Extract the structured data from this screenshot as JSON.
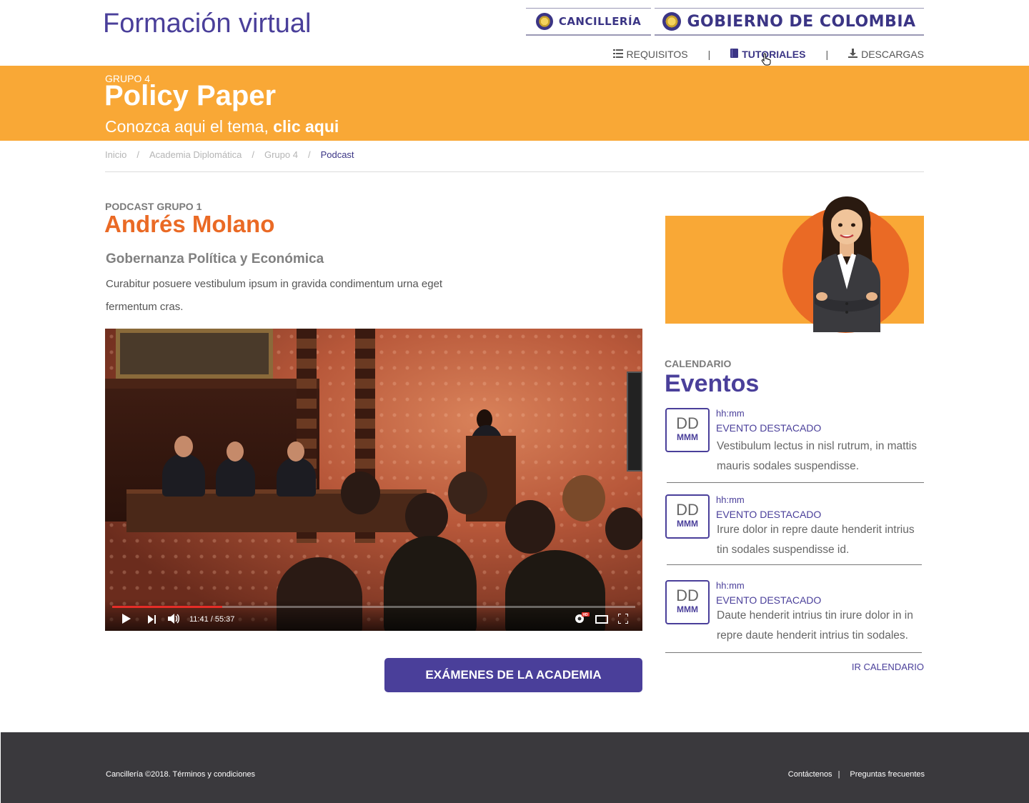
{
  "header": {
    "site_title": "Formación virtual",
    "brand_cancilleria": "CANCILLERÍA",
    "brand_gobierno": "GOBIERNO DE COLOMBIA"
  },
  "nav": {
    "items": [
      {
        "label": "REQUISITOS",
        "icon": "list-icon"
      },
      {
        "label": "TUTORIALES",
        "icon": "book-icon",
        "active": true
      },
      {
        "label": "DESCARGAS",
        "icon": "download-icon"
      }
    ],
    "separator": "|"
  },
  "banner": {
    "group": "GRUPO 4",
    "title": "Policy Paper",
    "subtitle_prefix": "Conozca aqui el tema, ",
    "subtitle_link": "clic aqui"
  },
  "breadcrumb": {
    "items": [
      "Inicio",
      "Academia Diplomática",
      "Grupo 4",
      "Podcast"
    ],
    "separator": "/"
  },
  "content": {
    "kicker": "PODCAST GRUPO 1",
    "name": "Andrés Molano",
    "topic": "Gobernanza Política y Económica",
    "description": "Curabitur posuere vestibulum ipsum in gravida condimentum urna eget fermentum cras."
  },
  "video": {
    "time": "11:41 / 55:37",
    "progress": 0.21,
    "hd_badge": "HD"
  },
  "exam_button": "EXÁMENES DE LA ACADEMIA",
  "calendar": {
    "kicker": "CALENDARIO",
    "title": "Eventos",
    "events": [
      {
        "day": "DD",
        "month": "MMM",
        "time": "hh:mm",
        "title": "EVENTO DESTACADO",
        "desc": "Vestibulum lectus in nisl rutrum, in mattis mauris sodales suspendisse."
      },
      {
        "day": "DD",
        "month": "MMM",
        "time": "hh:mm",
        "title": "EVENTO DESTACADO",
        "desc": "Irure dolor in repre daute henderit intrius tin sodales suspendisse id."
      },
      {
        "day": "DD",
        "month": "MMM",
        "time": "hh:mm",
        "title": "EVENTO DESTACADO",
        "desc": "Daute henderit intrius tin irure dolor in in repre daute henderit intrius tin sodales."
      }
    ],
    "link": "IR CALENDARIO"
  },
  "footer": {
    "copyright": "Cancillería ©2018. Términos y condiciones",
    "link_contact": "Contáctenos",
    "link_sep": "|",
    "link_faq": "Preguntas frecuentes"
  },
  "colors": {
    "primary": "#4a3f9a",
    "orange": "#f9a836",
    "accent_orange": "#ea6a25",
    "footer": "#3a393d"
  }
}
